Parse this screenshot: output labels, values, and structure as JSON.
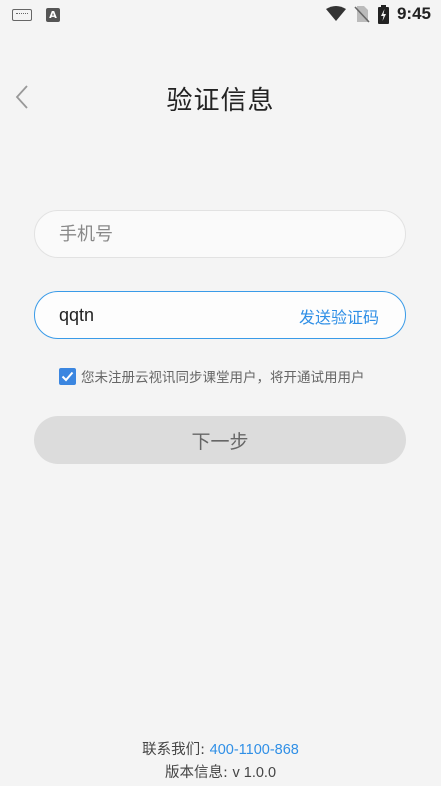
{
  "status_bar": {
    "time": "9:45",
    "icons": [
      "keyboard-icon",
      "a-app-icon",
      "wifi-icon",
      "no-sim-icon",
      "battery-charging-icon"
    ]
  },
  "header": {
    "title": "验证信息",
    "back_icon": "chevron-left-icon"
  },
  "form": {
    "phone": {
      "value": "",
      "placeholder": "手机号"
    },
    "code": {
      "value": "qqtn",
      "placeholder": "",
      "send_label": "发送验证码"
    },
    "agreement": {
      "checked": true,
      "text": "您未注册云视讯同步课堂用户，将开通试用用户"
    },
    "next_label": "下一步"
  },
  "footer": {
    "contact_label": "联系我们: ",
    "contact_phone": "400-1100-868",
    "version_label": "版本信息: ",
    "version_value": "v 1.0.0"
  },
  "colors": {
    "accent": "#2f8fe6",
    "checkbox": "#3b86e0",
    "background": "#f4f4f4",
    "button_disabled": "#dcdcdc"
  }
}
